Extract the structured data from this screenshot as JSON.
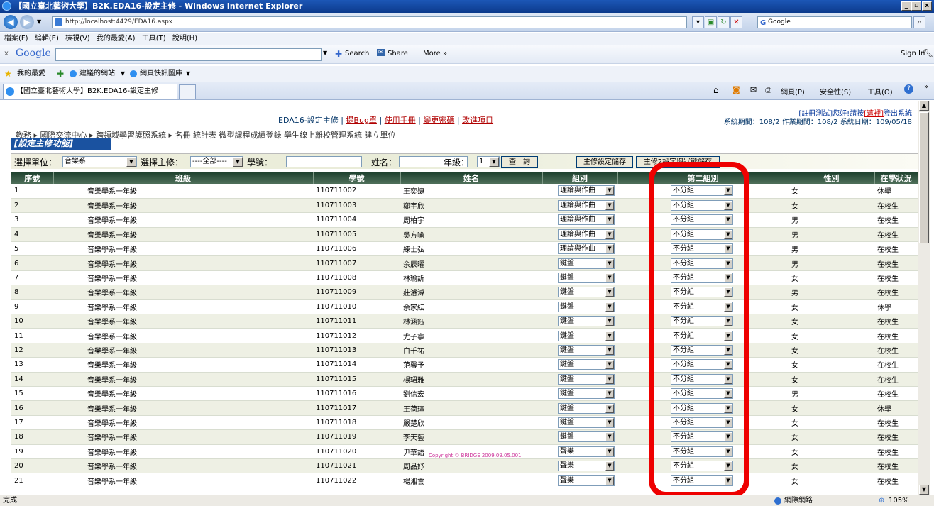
{
  "window": {
    "title": "【國立臺北藝術大學】B2K.EDA16-設定主修 - Windows Internet Explorer",
    "min": "_",
    "max": "▫",
    "close": "x"
  },
  "address": {
    "url": "http://localhost:4429/EDA16.aspx",
    "search_placeholder": "Google"
  },
  "menu": [
    "檔案(F)",
    "編輯(E)",
    "檢視(V)",
    "我的最愛(A)",
    "工具(T)",
    "說明(H)"
  ],
  "googlebar": {
    "close": "x",
    "logo": "Google",
    "search": "Search",
    "share": "Share",
    "more": "More »",
    "signin": "Sign In"
  },
  "favorites": {
    "label": "我的最愛",
    "suggested": "建議的網站",
    "gallery": "網頁快訊圖庫"
  },
  "tab": {
    "title": "【國立臺北藝術大學】B2K.EDA16-設定主修"
  },
  "ie_tools": {
    "page": "網頁(P)",
    "safety": "安全性(S)",
    "tools": "工具(O)"
  },
  "page": {
    "header_title": "EDA16-設定主修",
    "links": [
      "提Bug單",
      "使用手冊",
      "變更密碼",
      "改進項目"
    ],
    "login_prefix": "[註冊測試]您好!請按",
    "login_here": "[這裡]",
    "login_suffix": "登出系統",
    "period_info": "系統期間：108/2  作業期間：108/2  系統日期：109/05/18",
    "nav": "教務 ▸  國際交流中心 ▸  跨領域學習護照系統 ▸  名冊  統計表  微型課程成績登錄  學生線上離校管理系統  建立單位",
    "function_title": "[設定主修功能]"
  },
  "filters": {
    "unit_label": "選擇單位：",
    "unit_value": "音樂系",
    "major_label": "選擇主修：",
    "major_value": "----全部----",
    "id_label": "學號：",
    "name_label": "姓名：",
    "grade_label": "年級：",
    "grade_value": "1",
    "query_btn": "查　詢",
    "save1_btn": "主修設定儲存",
    "save2_btn": "主修2設定與狀態儲存"
  },
  "table": {
    "headers": [
      "序號",
      "班級",
      "學號",
      "姓名",
      "組別",
      "第二組別",
      "性別",
      "在學狀況"
    ],
    "rows": [
      [
        "1",
        "音樂學系一年級",
        "110711002",
        "王奕婕",
        "理論與作曲",
        "不分組",
        "女",
        "休學"
      ],
      [
        "2",
        "音樂學系一年級",
        "110711003",
        "鄭宇欣",
        "理論與作曲",
        "不分組",
        "女",
        "在校生"
      ],
      [
        "3",
        "音樂學系一年級",
        "110711004",
        "周柏宇",
        "理論與作曲",
        "不分組",
        "男",
        "在校生"
      ],
      [
        "4",
        "音樂學系一年級",
        "110711005",
        "吳方喻",
        "理論與作曲",
        "不分組",
        "男",
        "在校生"
      ],
      [
        "5",
        "音樂學系一年級",
        "110711006",
        "練士弘",
        "理論與作曲",
        "不分組",
        "男",
        "在校生"
      ],
      [
        "6",
        "音樂學系一年級",
        "110711007",
        "余辰曜",
        "鍵盤",
        "不分組",
        "男",
        "在校生"
      ],
      [
        "7",
        "音樂學系一年級",
        "110711008",
        "林瑜訢",
        "鍵盤",
        "不分組",
        "女",
        "在校生"
      ],
      [
        "8",
        "音樂學系一年級",
        "110711009",
        "莊濬溥",
        "鍵盤",
        "不分組",
        "男",
        "在校生"
      ],
      [
        "9",
        "音樂學系一年級",
        "110711010",
        "余家紜",
        "鍵盤",
        "不分組",
        "女",
        "休學"
      ],
      [
        "10",
        "音樂學系一年級",
        "110711011",
        "林涵鈺",
        "鍵盤",
        "不分組",
        "女",
        "在校生"
      ],
      [
        "11",
        "音樂學系一年級",
        "110711012",
        "尤子寧",
        "鍵盤",
        "不分組",
        "女",
        "在校生"
      ],
      [
        "12",
        "音樂學系一年級",
        "110711013",
        "白千祐",
        "鍵盤",
        "不分組",
        "女",
        "在校生"
      ],
      [
        "13",
        "音樂學系一年級",
        "110711014",
        "范馨予",
        "鍵盤",
        "不分組",
        "女",
        "在校生"
      ],
      [
        "14",
        "音樂學系一年級",
        "110711015",
        "楊珺雅",
        "鍵盤",
        "不分組",
        "女",
        "在校生"
      ],
      [
        "15",
        "音樂學系一年級",
        "110711016",
        "劉信宏",
        "鍵盤",
        "不分組",
        "男",
        "在校生"
      ],
      [
        "16",
        "音樂學系一年級",
        "110711017",
        "王荷瑄",
        "鍵盤",
        "不分組",
        "女",
        "休學"
      ],
      [
        "17",
        "音樂學系一年級",
        "110711018",
        "嚴楚欣",
        "鍵盤",
        "不分組",
        "女",
        "在校生"
      ],
      [
        "18",
        "音樂學系一年級",
        "110711019",
        "李天藝",
        "鍵盤",
        "不分組",
        "女",
        "在校生"
      ],
      [
        "19",
        "音樂學系一年級",
        "110711020",
        "尹華語",
        "聲樂",
        "不分組",
        "女",
        "在校生"
      ],
      [
        "20",
        "音樂學系一年級",
        "110711021",
        "周品妤",
        "聲樂",
        "不分組",
        "女",
        "在校生"
      ],
      [
        "21",
        "音樂學系一年級",
        "110711022",
        "楊湘雲",
        "聲樂",
        "不分組",
        "女",
        "在校生"
      ]
    ]
  },
  "copyright": "Copyright © BRIDGE 2009.09.05.001",
  "status": {
    "left": "完成",
    "zone": "網際網路",
    "zoom": "105%"
  },
  "colors": {
    "highlight": "#ee0000",
    "header_bg": "#2b4a37",
    "title_bg": "#1a52a0"
  }
}
